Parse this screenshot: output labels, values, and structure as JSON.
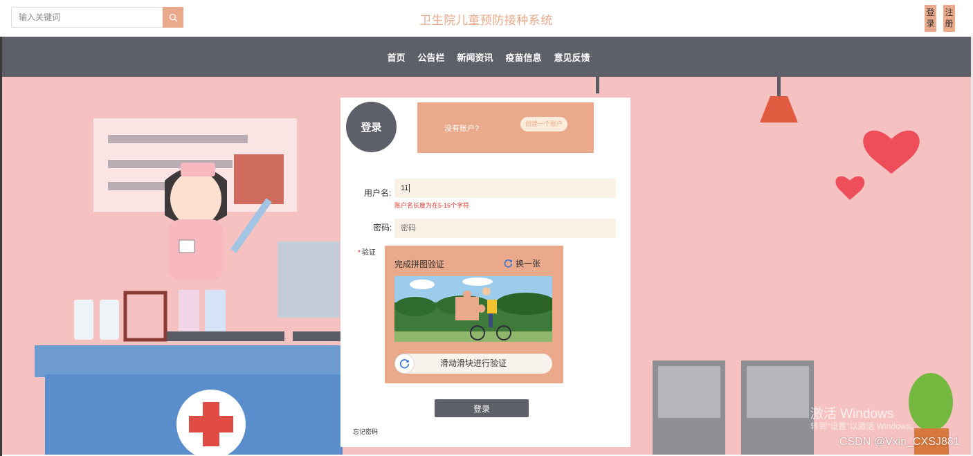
{
  "search": {
    "placeholder": "输入关键词",
    "icon": "search-icon"
  },
  "site": {
    "title": "卫生院儿童预防接种系统"
  },
  "auth": {
    "login": "登录",
    "register": "注册"
  },
  "nav": {
    "items": [
      "首页",
      "公告栏",
      "新闻资讯",
      "疫苗信息",
      "意见反馈"
    ]
  },
  "login_card": {
    "badge": "登录",
    "no_account": "没有账户?",
    "create_account": "创建一个账户",
    "username_label": "用户名:",
    "username_value": "11",
    "username_error": "账户名长度为在5-16个字符",
    "password_label": "密码:",
    "password_placeholder": "密码",
    "verify_required": "*",
    "verify_label": "验证",
    "captcha_title": "完成拼图验证",
    "captcha_refresh": "换一张",
    "slider_text": "滑动滑块进行验证",
    "submit": "登录",
    "forgot": "忘记密码"
  },
  "watermarks": {
    "windows_title": "激活 Windows",
    "windows_sub": "转到\"设置\"以激活 Windows。",
    "csdn": "CSDN @Vxin_CXSJ881"
  },
  "colors": {
    "accent": "#e9a98a",
    "nav_bg": "#5d6069",
    "scene_bg": "#f6c2c1",
    "field_bg": "#faf1e6",
    "error": "#d9332a"
  }
}
